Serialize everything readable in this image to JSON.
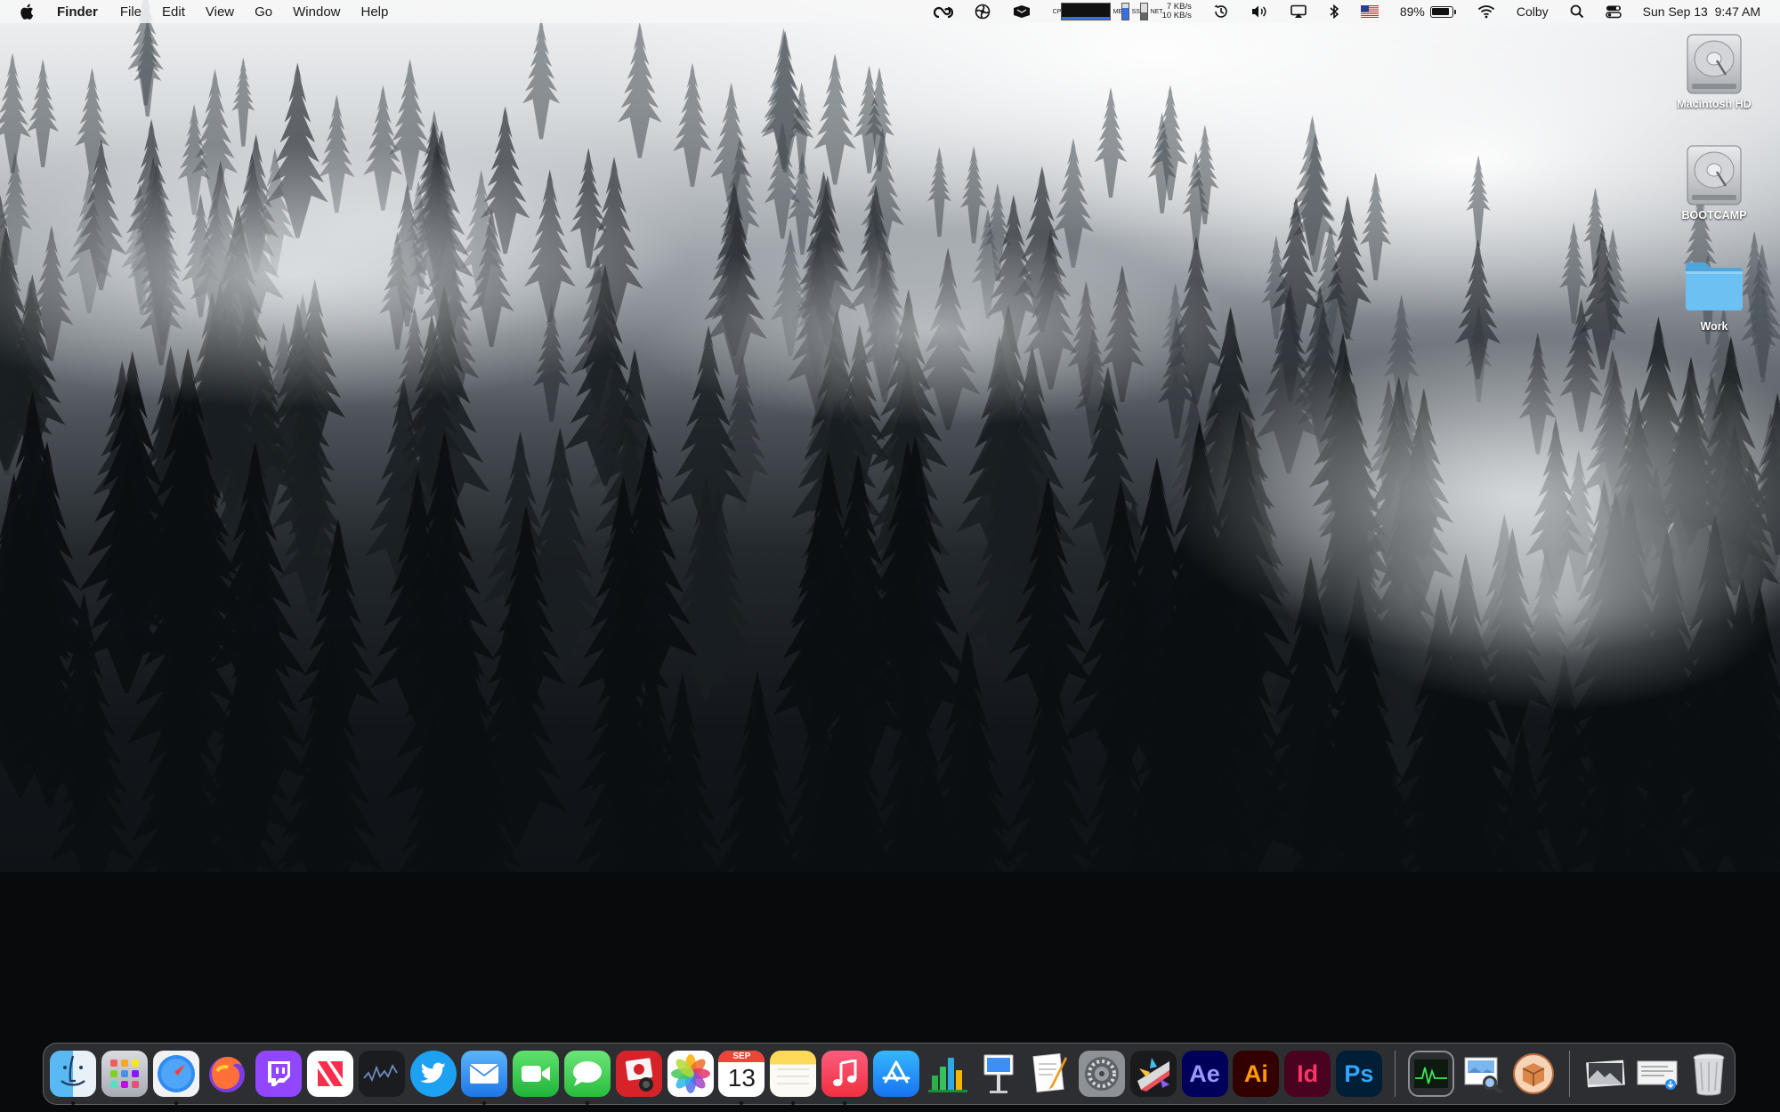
{
  "menubar": {
    "app_name": "Finder",
    "menus": [
      "File",
      "Edit",
      "View",
      "Go",
      "Window",
      "Help"
    ],
    "net_up": "7 KB/s",
    "net_down": "10 KB/s",
    "cpu_label": "CPU",
    "mem_label": "MEM",
    "ssd_label": "SSD",
    "net_label": "NET",
    "battery_percent": "89%",
    "battery_level": 0.89,
    "user": "Colby",
    "clock": "Sun Sep 13  9:47 AM",
    "flag_icon": "us-flag-icon"
  },
  "desktop": {
    "icons": [
      {
        "label": "Macintosh HD",
        "icon": "hard-drive-icon"
      },
      {
        "label": "BOOTCAMP",
        "icon": "hard-drive-icon"
      },
      {
        "label": "Work",
        "icon": "folder-icon"
      }
    ]
  },
  "dock": {
    "calendar_month": "SEP",
    "calendar_day": "13",
    "ae_label": "Ae",
    "ai_label": "Ai",
    "id_label": "Id",
    "ps_label": "Ps",
    "apps": [
      {
        "name": "Finder",
        "running": true
      },
      {
        "name": "Launchpad",
        "running": false
      },
      {
        "name": "Safari",
        "running": true
      },
      {
        "name": "Firefox",
        "running": false
      },
      {
        "name": "Twitch",
        "running": false
      },
      {
        "name": "News",
        "running": false
      },
      {
        "name": "Stocks",
        "running": false
      },
      {
        "name": "Twitter",
        "running": false
      },
      {
        "name": "Mail",
        "running": true
      },
      {
        "name": "FaceTime",
        "running": false
      },
      {
        "name": "Messages",
        "running": true
      },
      {
        "name": "Photo Booth",
        "running": false
      },
      {
        "name": "Photos",
        "running": false
      },
      {
        "name": "Calendar",
        "running": true
      },
      {
        "name": "Notes",
        "running": true
      },
      {
        "name": "Music",
        "running": true
      },
      {
        "name": "App Store",
        "running": false
      },
      {
        "name": "Numbers",
        "running": false
      },
      {
        "name": "Keynote",
        "running": false
      },
      {
        "name": "Pages",
        "running": false
      },
      {
        "name": "System Preferences",
        "running": false
      },
      {
        "name": "Final Cut Pro",
        "running": false
      },
      {
        "name": "After Effects",
        "running": false
      },
      {
        "name": "Illustrator",
        "running": false
      },
      {
        "name": "InDesign",
        "running": false
      },
      {
        "name": "Photoshop",
        "running": false
      },
      {
        "name": "Activity Monitor",
        "running": false
      },
      {
        "name": "Preview",
        "running": false
      },
      {
        "name": "Archive Utility",
        "running": false
      },
      {
        "name": "Image Stack",
        "running": false
      },
      {
        "name": "Downloads Stack",
        "running": false
      },
      {
        "name": "Trash",
        "running": false
      }
    ]
  },
  "colors": {
    "menubar_bg": "#f6f6f6",
    "folder_blue": "#6cc0f2",
    "accent_blue": "#3b6fe0"
  }
}
